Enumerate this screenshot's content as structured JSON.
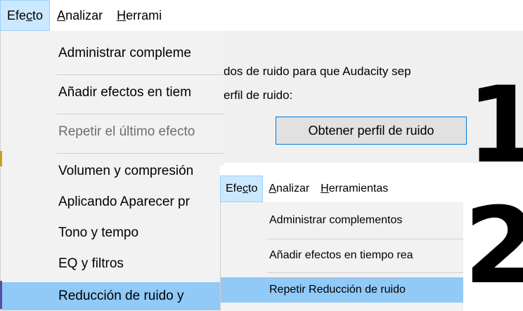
{
  "panel1": {
    "menubar": {
      "efecto": {
        "pre": "Efe",
        "key": "c",
        "post": "to"
      },
      "analizar": {
        "key": "A",
        "post": "nalizar"
      },
      "herramientas": {
        "key": "H",
        "post": "errami"
      }
    },
    "menu_items": [
      "Administrar compleme",
      "Añadir efectos en tiem",
      "Repetir el último efecto",
      "Volumen y compresión",
      "Aplicando Aparecer pr",
      "Tono y tempo",
      "EQ y filtros",
      "Reducción de ruido y"
    ],
    "dialog": {
      "line1": "dos de ruido para que Audacity sep",
      "line2": "erfil de ruido:",
      "button": "Obtener perfil de ruido"
    },
    "step_number": "1"
  },
  "panel2": {
    "menubar": {
      "efecto": {
        "pre": "Efe",
        "key": "c",
        "post": "to"
      },
      "analizar": {
        "key": "A",
        "post": "nalizar"
      },
      "herramientas": {
        "key": "H",
        "post": "erramientas"
      }
    },
    "menu_items": [
      "Administrar complementos",
      "Añadir efectos en tiempo rea",
      "Repetir Reducción de ruido"
    ],
    "step_number": "2"
  },
  "colors": {
    "menu_bg": "#f2f2f2",
    "highlight": "#91c9f7",
    "active_menu": "#cce8ff",
    "button_border": "#0078d7"
  }
}
